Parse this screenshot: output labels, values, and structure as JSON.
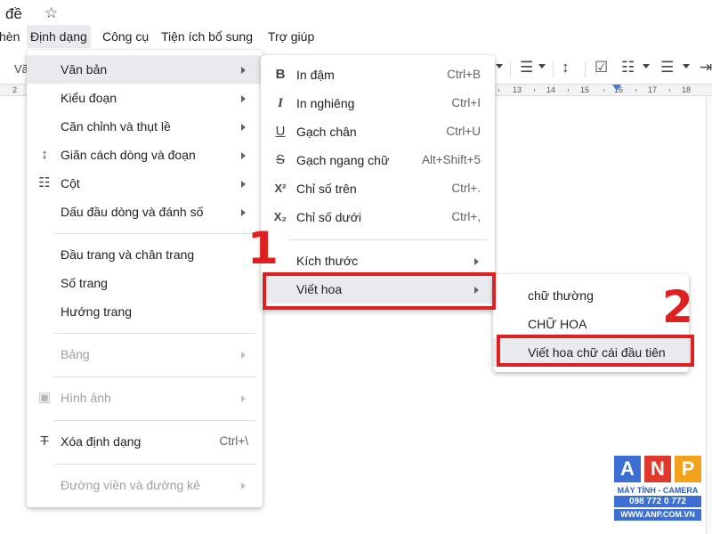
{
  "doc": {
    "title": "đề"
  },
  "menubar": {
    "items": [
      "hèn",
      "Định dạng",
      "Công cụ",
      "Tiện ích bổ sung",
      "Trợ giúp"
    ]
  },
  "toolbar": {
    "left_text": "Vă"
  },
  "ruler": {
    "labels": [
      "2",
      "13",
      "14",
      "15",
      "16",
      "17",
      "18"
    ]
  },
  "format_menu": {
    "items": [
      {
        "label": "Văn bản",
        "icon": "",
        "has_submenu": true,
        "disabled": false
      },
      {
        "label": "Kiểu đoạn",
        "icon": "",
        "has_submenu": true,
        "disabled": false
      },
      {
        "label": "Căn chỉnh và thụt lề",
        "icon": "",
        "has_submenu": true,
        "disabled": false
      },
      {
        "label": "Giãn cách dòng và đoạn",
        "icon": "line-spacing-icon",
        "has_submenu": true,
        "disabled": false
      },
      {
        "label": "Cột",
        "icon": "columns-icon",
        "has_submenu": true,
        "disabled": false
      },
      {
        "label": "Dấu đầu dòng và đánh số",
        "icon": "",
        "has_submenu": true,
        "disabled": false
      },
      {
        "label": "Đầu trang và chân trang",
        "icon": "",
        "has_submenu": false,
        "disabled": false
      },
      {
        "label": "Số trang",
        "icon": "",
        "has_submenu": false,
        "disabled": false
      },
      {
        "label": "Hướng trang",
        "icon": "",
        "has_submenu": false,
        "disabled": false
      },
      {
        "label": "Bảng",
        "icon": "",
        "has_submenu": true,
        "disabled": true
      },
      {
        "label": "Hình ảnh",
        "icon": "image-icon",
        "has_submenu": true,
        "disabled": true
      },
      {
        "label": "Xóa định dạng",
        "icon": "clear-format-icon",
        "shortcut": "Ctrl+\\",
        "has_submenu": false,
        "disabled": false
      },
      {
        "label": "Đường viền và đường kẻ",
        "icon": "",
        "has_submenu": true,
        "disabled": true
      }
    ]
  },
  "text_menu": {
    "items": [
      {
        "label": "In đậm",
        "icon_glyph": "B",
        "shortcut": "Ctrl+B"
      },
      {
        "label": "In nghiêng",
        "icon_glyph": "I",
        "shortcut": "Ctrl+I"
      },
      {
        "label": "Gạch chân",
        "icon_glyph": "U",
        "shortcut": "Ctrl+U"
      },
      {
        "label": "Gạch ngang chữ",
        "icon_glyph": "S",
        "shortcut": "Alt+Shift+5"
      },
      {
        "label": "Chỉ số trên",
        "icon_glyph": "X²",
        "shortcut": "Ctrl+."
      },
      {
        "label": "Chỉ số dưới",
        "icon_glyph": "X₂",
        "shortcut": "Ctrl+,"
      },
      {
        "label": "Kích thước",
        "has_submenu": true
      },
      {
        "label": "Viết hoa",
        "has_submenu": true
      }
    ]
  },
  "case_menu": {
    "items": [
      "chữ thường",
      "CHỮ HOA",
      "Viết hoa chữ cái đầu tiên"
    ]
  },
  "annotations": {
    "step1": "1",
    "step2": "2",
    "accent_color": "#e02020"
  },
  "watermark": {
    "letters": [
      "A",
      "N",
      "P"
    ],
    "letter_colors": [
      "#3b6fd4",
      "#e0392b",
      "#f2a21b"
    ],
    "line1": "MÁY TÍNH - CAMERA",
    "line2": "098 772 0 772",
    "line3": "WWW.ANP.COM.VN"
  }
}
